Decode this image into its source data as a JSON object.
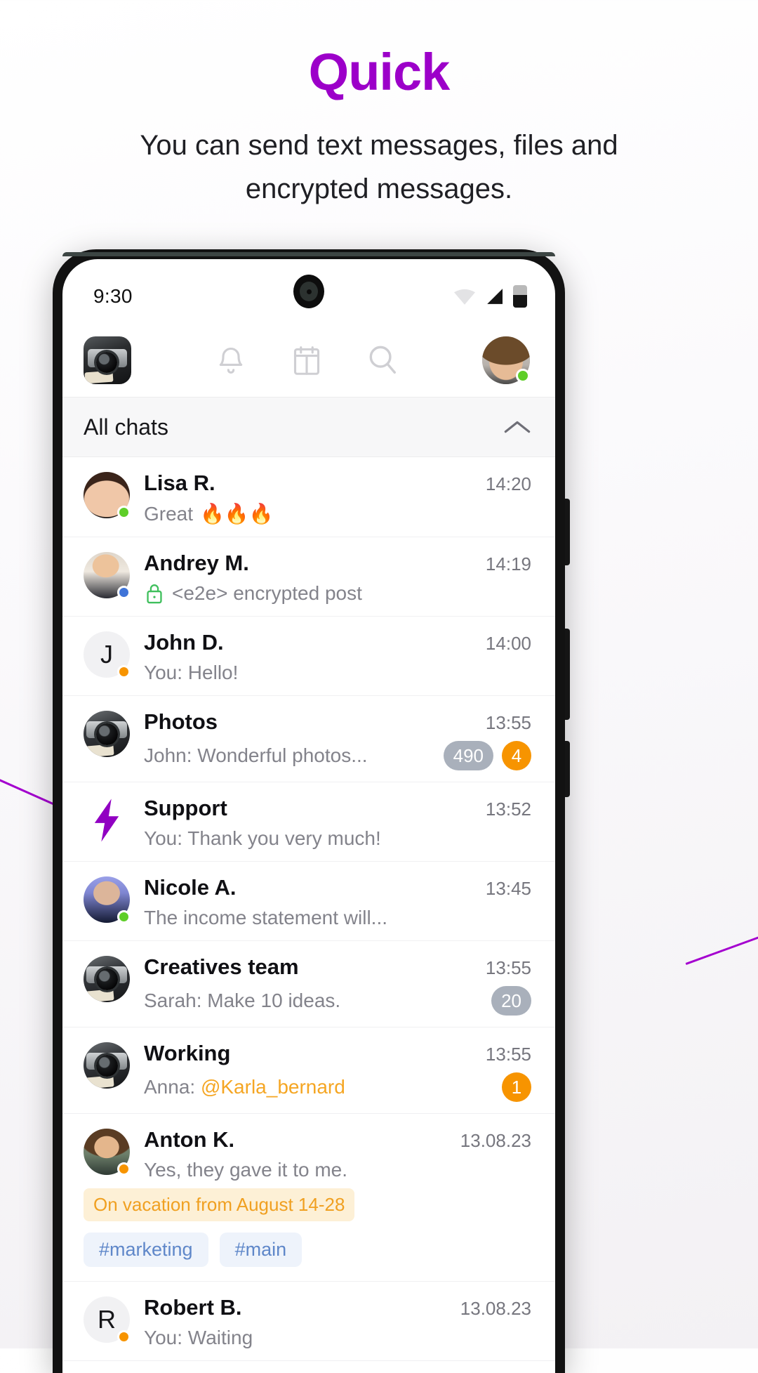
{
  "hero": {
    "title": "Quick",
    "subtitle": "You can send text messages, files and encrypted messages.",
    "title_color": "#9c00c9"
  },
  "status_bar": {
    "time": "9:30",
    "icons": [
      "wifi-icon",
      "signal-icon",
      "battery-icon"
    ]
  },
  "toolbar": {
    "app_logo": "camera-app-logo",
    "icons": [
      {
        "name": "bell-icon",
        "label": "Notifications"
      },
      {
        "name": "calendar-icon",
        "label": "Calendar"
      },
      {
        "name": "search-icon",
        "label": "Search"
      }
    ],
    "profile": {
      "name": "my-avatar",
      "status": "online",
      "status_color": "#5ece28"
    }
  },
  "section": {
    "title": "All chats",
    "collapse_icon": "chevron-up-icon"
  },
  "chats": [
    {
      "name": "Lisa R.",
      "time": "14:20",
      "message": "Great",
      "emoji": "🔥🔥🔥",
      "avatar": "av-lisa",
      "status_color": "#5ece28",
      "badges": []
    },
    {
      "name": "Andrey M.",
      "time": "14:19",
      "message": "<e2e> encrypted post",
      "avatar": "av-andrey",
      "status_color": "#3f74d8",
      "lock": true,
      "badges": []
    },
    {
      "name": "John D.",
      "time": "14:00",
      "message": "You: Hello!",
      "avatar": "av-john",
      "initial": "J",
      "status_color": "#f79400",
      "badges": []
    },
    {
      "name": "Photos",
      "time": "13:55",
      "message": "John: Wonderful photos...",
      "avatar": "av-cam",
      "badges": [
        {
          "text": "490",
          "color": "gray"
        },
        {
          "text": "4",
          "color": "orange"
        }
      ]
    },
    {
      "name": "Support",
      "time": "13:52",
      "message": "You: Thank you very much!",
      "avatar": "av-support",
      "icon": "lightning-bolt-icon",
      "badges": []
    },
    {
      "name": "Nicole A.",
      "time": "13:45",
      "message": "The income statement will...",
      "avatar": "av-nicole",
      "status_color": "#5ece28",
      "badges": []
    },
    {
      "name": "Creatives team",
      "time": "13:55",
      "message": "Sarah: Make 10 ideas.",
      "avatar": "av-cam",
      "badges": [
        {
          "text": "20",
          "color": "gray"
        }
      ]
    },
    {
      "name": "Working",
      "time": "13:55",
      "message_prefix": "Anna: ",
      "mention": "@Karla_bernard",
      "avatar": "av-cam",
      "badges": [
        {
          "text": "1",
          "color": "orange"
        }
      ]
    },
    {
      "name": "Anton K.",
      "time": "13.08.23",
      "message": "Yes, they gave it to me.",
      "avatar": "av-anton",
      "status_color": "#f79400",
      "badges": []
    },
    {
      "name": "Robert B.",
      "time": "13.08.23",
      "message": "You: Waiting",
      "avatar": "av-robert",
      "initial": "R",
      "status_color": "#f79400",
      "badges": []
    }
  ],
  "vacation_banner": "On vacation from August 14-28",
  "tags": [
    "#marketing",
    "#main"
  ]
}
